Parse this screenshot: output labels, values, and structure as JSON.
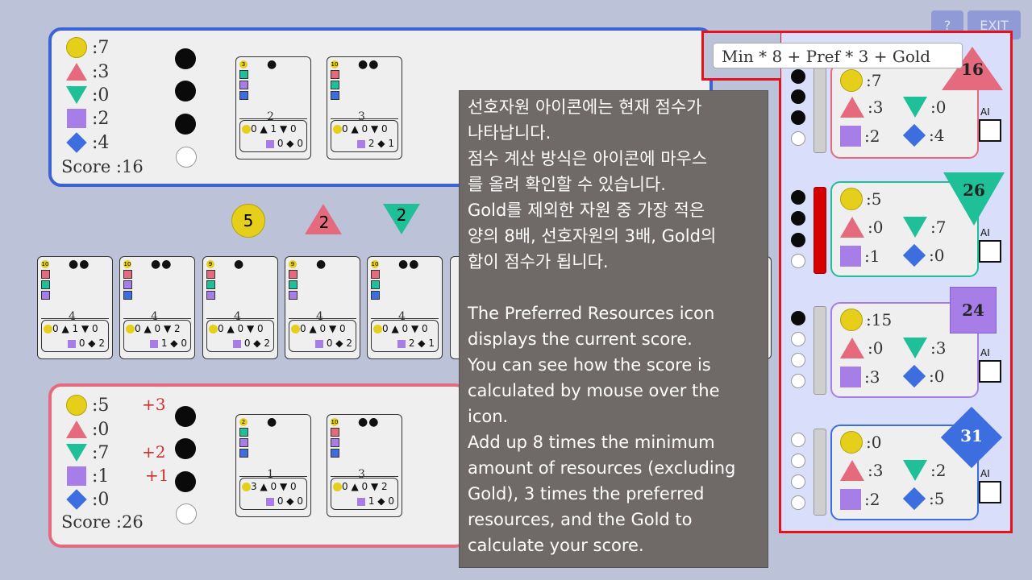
{
  "top_buttons": {
    "help": "?",
    "exit": "EXIT"
  },
  "player_top": {
    "resources": {
      "gold": "7",
      "pink": "3",
      "green": "0",
      "purple": "2",
      "blue": "4"
    },
    "score_label": "Score :16",
    "dots": [
      "on",
      "on",
      "on",
      "off"
    ],
    "cards": [
      {
        "cost": "3",
        "dots": "●",
        "power": "2",
        "pay1": "0 ▲ 1 ▼ 0",
        "pay2": "0 ◆ 0"
      },
      {
        "cost": "10",
        "dots": "●●",
        "power": "3",
        "pay1": "0 ▲ 0 ▼ 0",
        "pay2": "2 ◆ 1"
      }
    ]
  },
  "market_tokens": {
    "gold": "5",
    "pink": "2",
    "green": "2"
  },
  "market_cards": [
    {
      "cost": "10",
      "dots": "●●",
      "power": "4",
      "pay1": "0 ▲ 1 ▼ 0",
      "pay2": "0 ◆ 2"
    },
    {
      "cost": "10",
      "dots": "●●",
      "power": "4",
      "pay1": "0 ▲ 0 ▼ 2",
      "pay2": "1 ◆ 0"
    },
    {
      "cost": "9",
      "dots": "●",
      "power": "4",
      "pay1": "0 ▲ 0 ▼ 0",
      "pay2": "0 ◆ 2"
    },
    {
      "cost": "9",
      "dots": "●",
      "power": "4",
      "pay1": "0 ▲ 0 ▼ 0",
      "pay2": "0 ◆ 2"
    },
    {
      "cost": "10",
      "dots": "●●",
      "power": "4",
      "pay1": "0 ▲ 0 ▼ 0",
      "pay2": "2 ◆ 1"
    }
  ],
  "player_bottom": {
    "resources": {
      "gold": "5",
      "pink": "0",
      "green": "7",
      "purple": "1",
      "blue": "0"
    },
    "deltas": {
      "gold": "+3",
      "green": "+2",
      "purple": "+1"
    },
    "score_label": "Score :26",
    "cards": [
      {
        "cost": "2",
        "dots": "●",
        "power": "1",
        "pay1": "3 ▲ 0 ▼ 0",
        "pay2": "0 ◆ 0"
      },
      {
        "cost": "10",
        "dots": "●●",
        "power": "3",
        "pay1": "0 ▲ 0 ▼ 2",
        "pay2": "1 ◆ 0"
      }
    ]
  },
  "formula": "Min * 8 + Pref * 3 + Gold",
  "tooltip_text": "선호자원 아이콘에는 현재 점수가\n나타납니다.\n점수 계산 방식은 아이콘에 마우스\n를 올려 확인할 수 있습니다.\nGold를 제외한 자원 중 가장 적은\n양의 8배, 선호자원의 3배, Gold의\n합이 점수가 됩니다.\n\nThe Preferred Resources icon\ndisplays the current score.\nYou can see how the score is\ncalculated by mouse over the\nicon.\nAdd up 8 times the minimum\namount of resources (excluding\nGold), 3 times the preferred\nresources, and the Gold to\ncalculate your score.",
  "opponents": [
    {
      "gold": "7",
      "pink": "3",
      "green": "0",
      "purple": "2",
      "blue": "4",
      "score": "16",
      "pref": "pink",
      "ai": "AI"
    },
    {
      "gold": "5",
      "pink": "0",
      "green": "7",
      "purple": "1",
      "blue": "0",
      "score": "26",
      "pref": "green",
      "ai": "AI"
    },
    {
      "gold": "15",
      "pink": "0",
      "green": "3",
      "purple": "3",
      "blue": "0",
      "score": "24",
      "pref": "purple",
      "ai": "AI"
    },
    {
      "gold": "0",
      "pink": "3",
      "green": "2",
      "purple": "2",
      "blue": "5",
      "score": "31",
      "pref": "blue",
      "ai": "AI"
    }
  ],
  "colors": {
    "gold": "#e6cf1a",
    "pink": "#e66a7e",
    "green": "#1fbf97",
    "purple": "#a77ee8",
    "blue": "#3d6ee0",
    "highlight": "#e8101a"
  }
}
